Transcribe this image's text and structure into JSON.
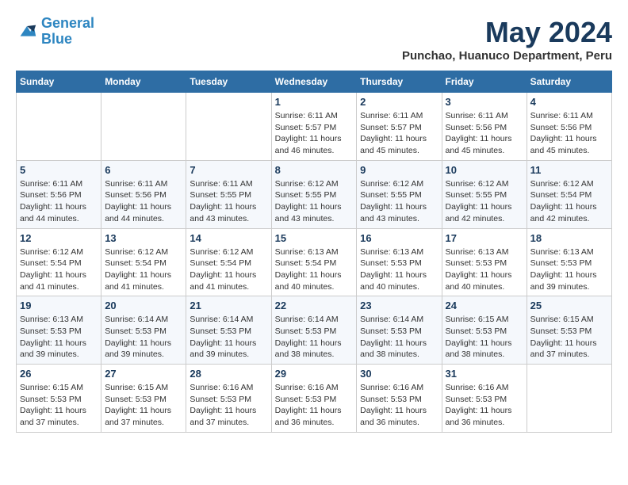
{
  "logo": {
    "line1": "General",
    "line2": "Blue"
  },
  "title": "May 2024",
  "subtitle": "Punchao, Huanuco Department, Peru",
  "days_of_week": [
    "Sunday",
    "Monday",
    "Tuesday",
    "Wednesday",
    "Thursday",
    "Friday",
    "Saturday"
  ],
  "weeks": [
    [
      {
        "day": "",
        "info": ""
      },
      {
        "day": "",
        "info": ""
      },
      {
        "day": "",
        "info": ""
      },
      {
        "day": "1",
        "info": "Sunrise: 6:11 AM\nSunset: 5:57 PM\nDaylight: 11 hours and 46 minutes."
      },
      {
        "day": "2",
        "info": "Sunrise: 6:11 AM\nSunset: 5:57 PM\nDaylight: 11 hours and 45 minutes."
      },
      {
        "day": "3",
        "info": "Sunrise: 6:11 AM\nSunset: 5:56 PM\nDaylight: 11 hours and 45 minutes."
      },
      {
        "day": "4",
        "info": "Sunrise: 6:11 AM\nSunset: 5:56 PM\nDaylight: 11 hours and 45 minutes."
      }
    ],
    [
      {
        "day": "5",
        "info": "Sunrise: 6:11 AM\nSunset: 5:56 PM\nDaylight: 11 hours and 44 minutes."
      },
      {
        "day": "6",
        "info": "Sunrise: 6:11 AM\nSunset: 5:56 PM\nDaylight: 11 hours and 44 minutes."
      },
      {
        "day": "7",
        "info": "Sunrise: 6:11 AM\nSunset: 5:55 PM\nDaylight: 11 hours and 43 minutes."
      },
      {
        "day": "8",
        "info": "Sunrise: 6:12 AM\nSunset: 5:55 PM\nDaylight: 11 hours and 43 minutes."
      },
      {
        "day": "9",
        "info": "Sunrise: 6:12 AM\nSunset: 5:55 PM\nDaylight: 11 hours and 43 minutes."
      },
      {
        "day": "10",
        "info": "Sunrise: 6:12 AM\nSunset: 5:55 PM\nDaylight: 11 hours and 42 minutes."
      },
      {
        "day": "11",
        "info": "Sunrise: 6:12 AM\nSunset: 5:54 PM\nDaylight: 11 hours and 42 minutes."
      }
    ],
    [
      {
        "day": "12",
        "info": "Sunrise: 6:12 AM\nSunset: 5:54 PM\nDaylight: 11 hours and 41 minutes."
      },
      {
        "day": "13",
        "info": "Sunrise: 6:12 AM\nSunset: 5:54 PM\nDaylight: 11 hours and 41 minutes."
      },
      {
        "day": "14",
        "info": "Sunrise: 6:12 AM\nSunset: 5:54 PM\nDaylight: 11 hours and 41 minutes."
      },
      {
        "day": "15",
        "info": "Sunrise: 6:13 AM\nSunset: 5:54 PM\nDaylight: 11 hours and 40 minutes."
      },
      {
        "day": "16",
        "info": "Sunrise: 6:13 AM\nSunset: 5:53 PM\nDaylight: 11 hours and 40 minutes."
      },
      {
        "day": "17",
        "info": "Sunrise: 6:13 AM\nSunset: 5:53 PM\nDaylight: 11 hours and 40 minutes."
      },
      {
        "day": "18",
        "info": "Sunrise: 6:13 AM\nSunset: 5:53 PM\nDaylight: 11 hours and 39 minutes."
      }
    ],
    [
      {
        "day": "19",
        "info": "Sunrise: 6:13 AM\nSunset: 5:53 PM\nDaylight: 11 hours and 39 minutes."
      },
      {
        "day": "20",
        "info": "Sunrise: 6:14 AM\nSunset: 5:53 PM\nDaylight: 11 hours and 39 minutes."
      },
      {
        "day": "21",
        "info": "Sunrise: 6:14 AM\nSunset: 5:53 PM\nDaylight: 11 hours and 39 minutes."
      },
      {
        "day": "22",
        "info": "Sunrise: 6:14 AM\nSunset: 5:53 PM\nDaylight: 11 hours and 38 minutes."
      },
      {
        "day": "23",
        "info": "Sunrise: 6:14 AM\nSunset: 5:53 PM\nDaylight: 11 hours and 38 minutes."
      },
      {
        "day": "24",
        "info": "Sunrise: 6:15 AM\nSunset: 5:53 PM\nDaylight: 11 hours and 38 minutes."
      },
      {
        "day": "25",
        "info": "Sunrise: 6:15 AM\nSunset: 5:53 PM\nDaylight: 11 hours and 37 minutes."
      }
    ],
    [
      {
        "day": "26",
        "info": "Sunrise: 6:15 AM\nSunset: 5:53 PM\nDaylight: 11 hours and 37 minutes."
      },
      {
        "day": "27",
        "info": "Sunrise: 6:15 AM\nSunset: 5:53 PM\nDaylight: 11 hours and 37 minutes."
      },
      {
        "day": "28",
        "info": "Sunrise: 6:16 AM\nSunset: 5:53 PM\nDaylight: 11 hours and 37 minutes."
      },
      {
        "day": "29",
        "info": "Sunrise: 6:16 AM\nSunset: 5:53 PM\nDaylight: 11 hours and 36 minutes."
      },
      {
        "day": "30",
        "info": "Sunrise: 6:16 AM\nSunset: 5:53 PM\nDaylight: 11 hours and 36 minutes."
      },
      {
        "day": "31",
        "info": "Sunrise: 6:16 AM\nSunset: 5:53 PM\nDaylight: 11 hours and 36 minutes."
      },
      {
        "day": "",
        "info": ""
      }
    ]
  ]
}
